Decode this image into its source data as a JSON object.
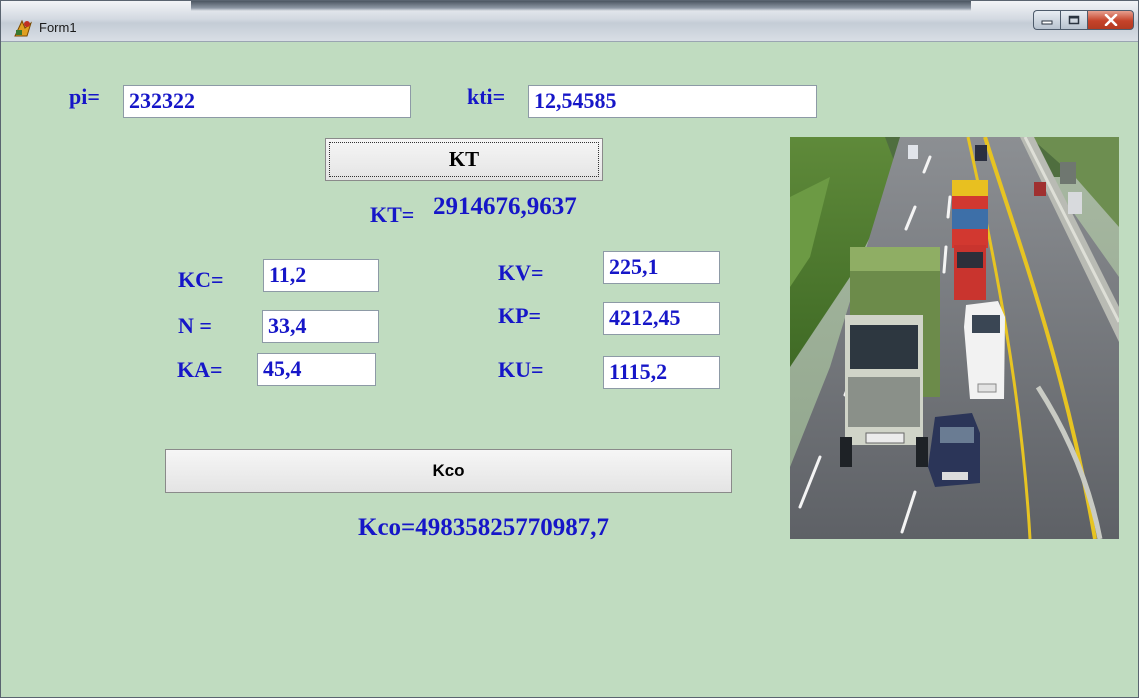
{
  "window": {
    "title": "Form1",
    "icon": "delphi-form-icon",
    "controls": [
      "minimize-icon",
      "maximize-icon",
      "close-icon"
    ]
  },
  "form": {
    "pi_label": "pi=",
    "pi_value": "232322",
    "kti_label": "kti=",
    "kti_value": "12,54585",
    "kt_button": "KT",
    "kt_result_label": "KT=",
    "kt_result_value": "2914676,9637",
    "kc_label": "KC=",
    "kc_value": "11,2",
    "n_label": "N =",
    "n_value": "33,4",
    "ka_label": "KA=",
    "ka_value": "45,4",
    "kv_label": "KV=",
    "kv_value": "225,1",
    "kp_label": "KP=",
    "kp_value": "4212,45",
    "ku_label": "KU=",
    "ku_value": "1115,2",
    "kco_button": "Kco",
    "kco_result": "Kco=49835825770987,7"
  },
  "image": {
    "subject": "highway-with-trucks-photo"
  },
  "colors": {
    "form_background": "#c0dcc0",
    "label_text": "#1616c8"
  }
}
